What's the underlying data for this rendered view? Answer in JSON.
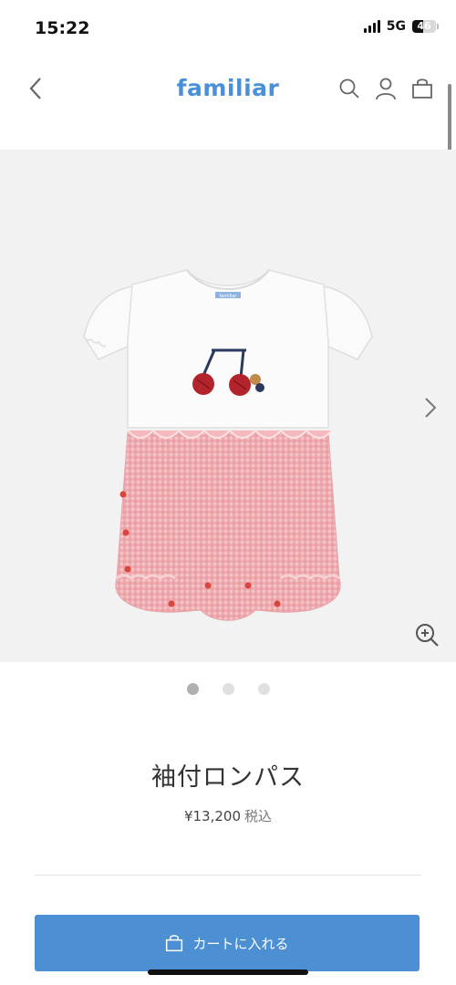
{
  "status_bar": {
    "time": "15:22",
    "network": "5G",
    "battery": "46"
  },
  "header": {
    "logo": "familiar",
    "back_icon": "chevron-left-icon",
    "icons": [
      "search-icon",
      "account-icon",
      "bag-icon"
    ],
    "brand_color": "#4a90d9"
  },
  "gallery": {
    "image_label": "familiar",
    "slide_count": 3,
    "active_slide": 1
  },
  "product": {
    "title": "袖付ロンパス",
    "price": "¥13,200",
    "tax_label": "税込"
  },
  "actions": {
    "add_to_cart_label": "カートに入れる",
    "button_color": "#4d8fd3"
  }
}
